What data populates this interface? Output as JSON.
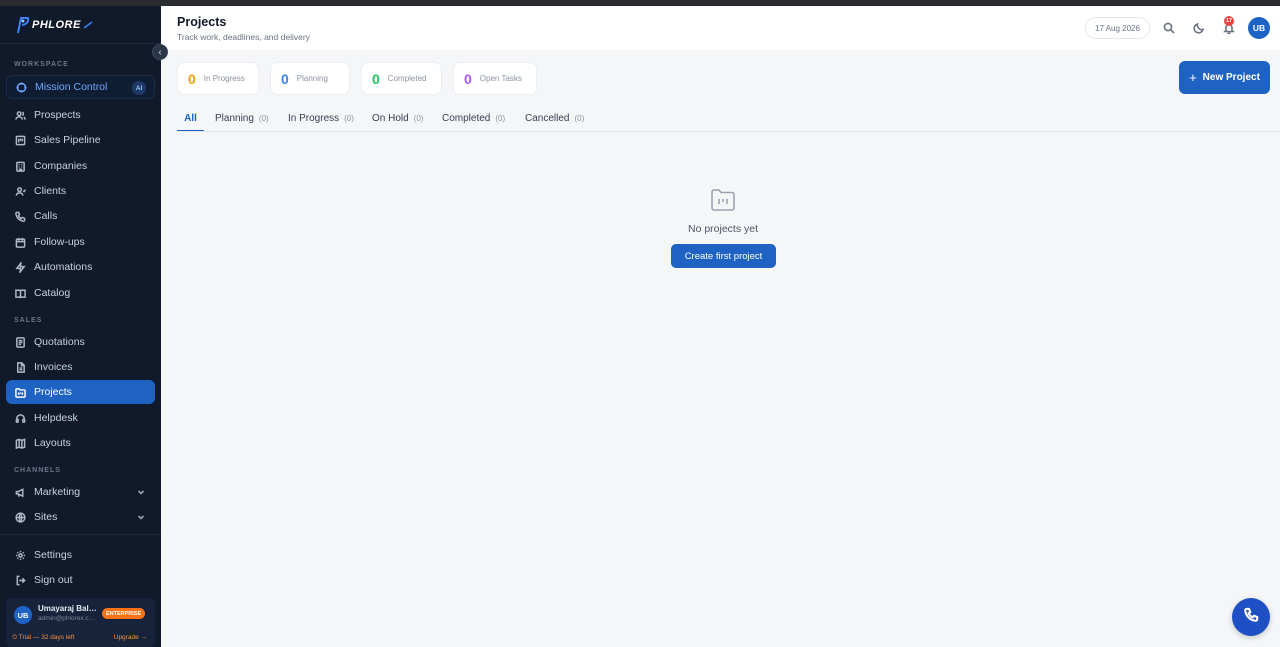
{
  "brand": {
    "name": "PHLORE"
  },
  "sidebar": {
    "sections": {
      "workspace": "WORKSPACE",
      "sales": "SALES",
      "channels": "CHANNELS"
    },
    "mission": {
      "label": "Mission Control",
      "badge": "AI"
    },
    "workspace_items": [
      {
        "label": "Prospects",
        "icon": "users-icon"
      },
      {
        "label": "Sales Pipeline",
        "icon": "pipeline-icon"
      },
      {
        "label": "Companies",
        "icon": "building-icon"
      },
      {
        "label": "Clients",
        "icon": "client-icon"
      },
      {
        "label": "Calls",
        "icon": "phone-icon"
      },
      {
        "label": "Follow-ups",
        "icon": "calendar-icon"
      },
      {
        "label": "Automations",
        "icon": "bolt-icon"
      },
      {
        "label": "Catalog",
        "icon": "book-icon"
      }
    ],
    "sales_items": [
      {
        "label": "Quotations",
        "icon": "quote-icon"
      },
      {
        "label": "Invoices",
        "icon": "invoice-icon"
      },
      {
        "label": "Projects",
        "icon": "folder-icon",
        "active": true
      },
      {
        "label": "Helpdesk",
        "icon": "headset-icon"
      },
      {
        "label": "Layouts",
        "icon": "layout-icon"
      }
    ],
    "channel_items": [
      {
        "label": "Marketing",
        "icon": "megaphone-icon"
      },
      {
        "label": "Sites",
        "icon": "globe-icon"
      }
    ],
    "footer_items": [
      {
        "label": "Settings",
        "icon": "gear-icon"
      },
      {
        "label": "Sign out",
        "icon": "signout-icon"
      }
    ],
    "user": {
      "initials": "UB",
      "name": "Umayaraj Balasubramanian",
      "email": "admin@phlorex.com",
      "plan": "ENTERPRISE",
      "trial": "⏲ Trial — 32 days left",
      "upgrade": "Upgrade →"
    }
  },
  "header": {
    "title": "Projects",
    "subtitle": "Track work, deadlines, and delivery",
    "date": "17 Aug 2026",
    "notifications": "17",
    "avatar": "UB"
  },
  "stats": [
    {
      "value": "0",
      "label": "In Progress",
      "color": "#f59e0b"
    },
    {
      "value": "0",
      "label": "Planning",
      "color": "#3b82f6"
    },
    {
      "value": "0",
      "label": "Completed",
      "color": "#22c55e"
    },
    {
      "value": "0",
      "label": "Open Tasks",
      "color": "#a855f7"
    }
  ],
  "new_project_label": "New Project",
  "tabs": [
    {
      "label": "All",
      "count": ""
    },
    {
      "label": "Planning",
      "count": "(0)"
    },
    {
      "label": "In Progress",
      "count": "(0)"
    },
    {
      "label": "On Hold",
      "count": "(0)"
    },
    {
      "label": "Completed",
      "count": "(0)"
    },
    {
      "label": "Cancelled",
      "count": "(0)"
    }
  ],
  "empty": {
    "message": "No projects yet",
    "cta": "Create first project"
  }
}
